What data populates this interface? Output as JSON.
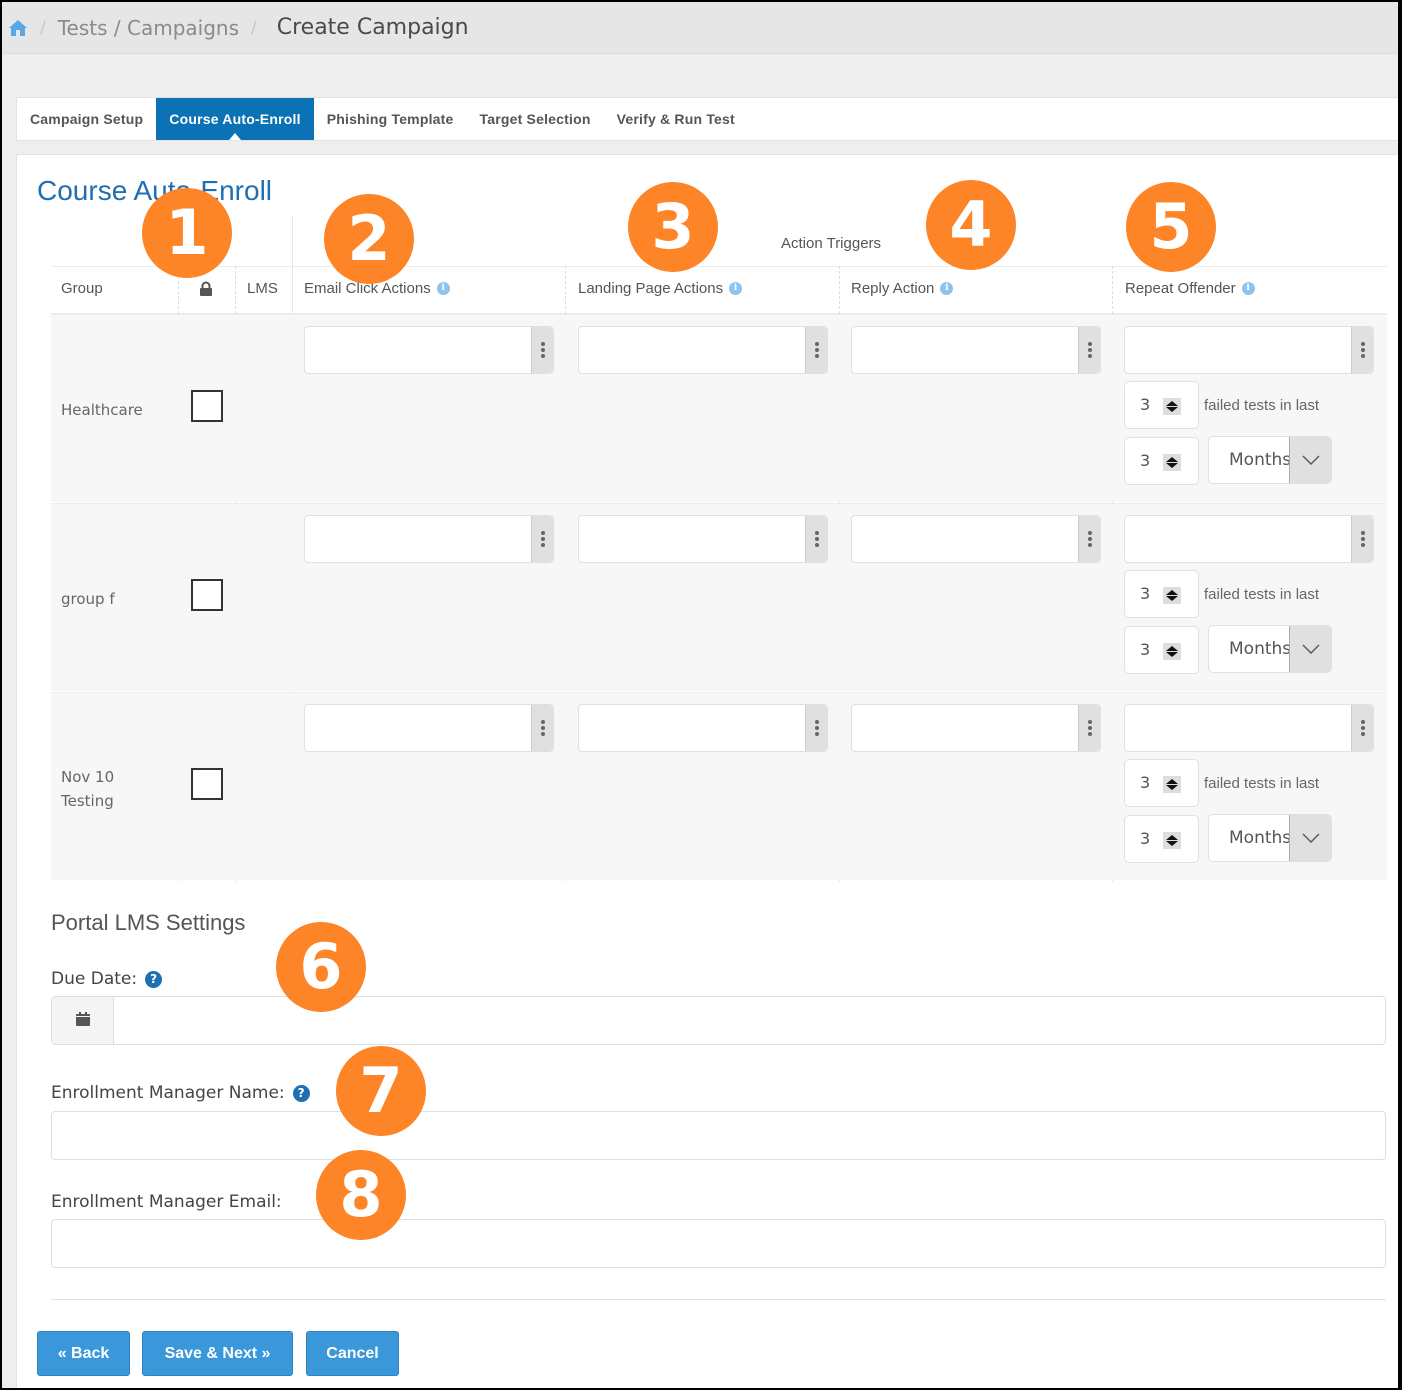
{
  "breadcrumb": {
    "home_icon": "home-icon",
    "separator": "/",
    "parent": "Tests / Campaigns",
    "current": "Create Campaign"
  },
  "tabs": [
    {
      "label": "Campaign Setup",
      "active": false
    },
    {
      "label": "Course Auto-Enroll",
      "active": true
    },
    {
      "label": "Phishing Template",
      "active": false
    },
    {
      "label": "Target Selection",
      "active": false
    },
    {
      "label": "Verify & Run Test",
      "active": false
    }
  ],
  "page_title": "Course Auto-Enroll",
  "table": {
    "super_header": "Action Triggers",
    "columns": {
      "group": "Group",
      "lock_icon": "lock-icon",
      "lms": "LMS",
      "email_click": "Email Click Actions",
      "landing_page": "Landing Page Actions",
      "reply": "Reply Action",
      "repeat_offender": "Repeat Offender"
    },
    "info_icon": "i",
    "rows": [
      {
        "group": "Healthcare",
        "lms_checked": false,
        "email_click": "",
        "landing_page": "",
        "reply": "",
        "repeat_offender": "",
        "failed_count": "3",
        "failed_label": "failed tests in last",
        "period_count": "3",
        "period_unit": "Months"
      },
      {
        "group": "group f",
        "lms_checked": false,
        "email_click": "",
        "landing_page": "",
        "reply": "",
        "repeat_offender": "",
        "failed_count": "3",
        "failed_label": "failed tests in last",
        "period_count": "3",
        "period_unit": "Months"
      },
      {
        "group": "Nov 10 Testing",
        "lms_checked": false,
        "email_click": "",
        "landing_page": "",
        "reply": "",
        "repeat_offender": "",
        "failed_count": "3",
        "failed_label": "failed tests in last",
        "period_count": "3",
        "period_unit": "Months"
      }
    ]
  },
  "lms_settings": {
    "title": "Portal LMS Settings",
    "due_date_label": "Due Date:",
    "due_date_value": "",
    "manager_name_label": "Enrollment Manager Name:",
    "manager_name_value": "",
    "manager_email_label": "Enrollment Manager Email:",
    "manager_email_value": "",
    "help_icon": "?"
  },
  "buttons": {
    "back": "« Back",
    "save_next": "Save & Next »",
    "cancel": "Cancel"
  },
  "annotations": [
    "1",
    "2",
    "3",
    "4",
    "5",
    "6",
    "7",
    "8"
  ],
  "colors": {
    "accent": "#0a72b5",
    "button": "#3a97da",
    "title": "#1f6fb2",
    "annotation": "#fd8427"
  }
}
